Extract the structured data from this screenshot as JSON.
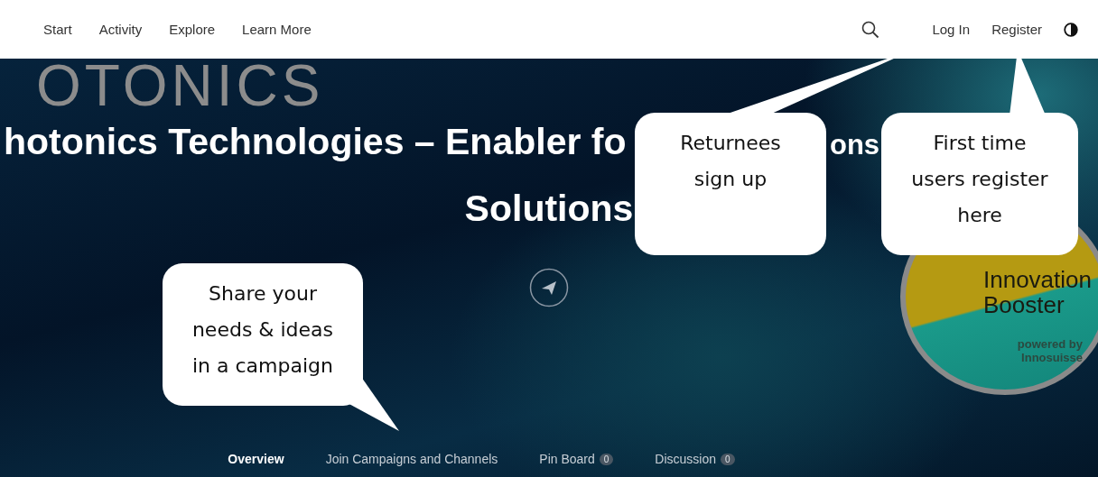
{
  "nav": {
    "links": [
      {
        "label": "Start"
      },
      {
        "label": "Activity"
      },
      {
        "label": "Explore"
      },
      {
        "label": "Learn More"
      }
    ],
    "account": [
      {
        "label": "Log In"
      },
      {
        "label": "Register"
      }
    ]
  },
  "hero": {
    "banner_word": "OTONICS",
    "title_fragments": [
      "hotonics Technologies – Enabler fo",
      "ons"
    ],
    "title_line_2": "Solutions",
    "badge": {
      "lines": [
        "Innovation",
        "Booster"
      ],
      "footer": [
        "powered by",
        "Innosuisse"
      ]
    }
  },
  "callouts": [
    {
      "text": "Returnees sign up"
    },
    {
      "text": "First time users register here"
    },
    {
      "text": "Share your needs & ideas in a campaign"
    }
  ],
  "tabs": [
    {
      "label": "Overview",
      "selected": true
    },
    {
      "label": "Join Campaigns and Channels",
      "selected": false
    },
    {
      "label": "Pin Board",
      "count": "0",
      "selected": false
    },
    {
      "label": "Discussion",
      "count": "0",
      "selected": false
    }
  ]
}
